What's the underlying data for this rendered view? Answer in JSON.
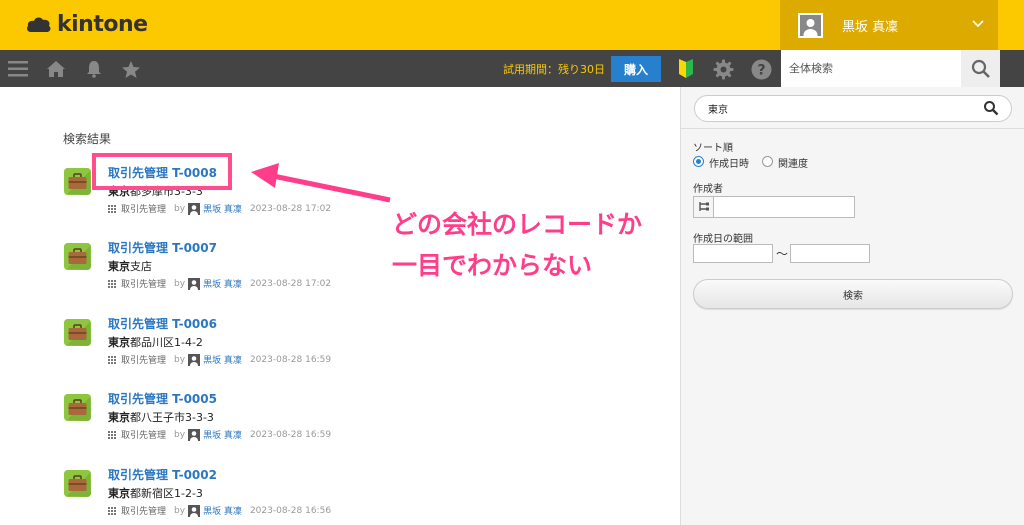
{
  "header": {
    "logo_text": "kintone",
    "user_name": "黒坂 真凜"
  },
  "toolbar": {
    "trial_text": "試用期間：残り30日",
    "buy_label": "購入",
    "global_search_placeholder": "全体検索"
  },
  "results": {
    "heading": "検索結果",
    "by": "by",
    "items": [
      {
        "title": "取引先管理 T-0008",
        "sub_bold": "東京",
        "sub_rest": "都多摩市3-3-3",
        "app": "取引先管理",
        "user": "黒坂 真凜",
        "date": "2023-08-28 17:02"
      },
      {
        "title": "取引先管理 T-0007",
        "sub_bold": "東京",
        "sub_rest": "支店",
        "app": "取引先管理",
        "user": "黒坂 真凜",
        "date": "2023-08-28 17:02"
      },
      {
        "title": "取引先管理 T-0006",
        "sub_bold": "東京",
        "sub_rest": "都品川区1-4-2",
        "app": "取引先管理",
        "user": "黒坂 真凜",
        "date": "2023-08-28 16:59"
      },
      {
        "title": "取引先管理 T-0005",
        "sub_bold": "東京",
        "sub_rest": "都八王子市3-3-3",
        "app": "取引先管理",
        "user": "黒坂 真凜",
        "date": "2023-08-28 16:59"
      },
      {
        "title": "取引先管理 T-0002",
        "sub_bold": "東京",
        "sub_rest": "都新宿区1-2-3",
        "app": "取引先管理",
        "user": "黒坂 真凜",
        "date": "2023-08-28 16:56"
      }
    ]
  },
  "annotation": {
    "line1": "どの会社のレコードか",
    "line2": "一目でわからない",
    "color": "#ff3d8b"
  },
  "sidebar": {
    "search_value": "東京",
    "sort_label": "ソート順",
    "sort_options": [
      "作成日時",
      "関連度"
    ],
    "sort_selected": "作成日時",
    "creator_label": "作成者",
    "date_range_label": "作成日の範囲",
    "range_sep": "〜",
    "search_button": "検索"
  },
  "colors": {
    "brand_yellow": "#fcc800",
    "toolbar_dark": "#444444",
    "link_blue": "#2b77c2",
    "buy_blue": "#2780cd"
  }
}
